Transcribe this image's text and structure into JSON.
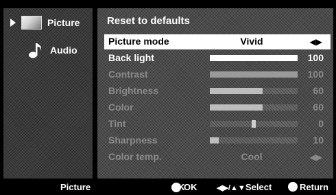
{
  "sidebar": {
    "items": [
      {
        "label": "Picture",
        "icon": "picture-icon",
        "selected": true
      },
      {
        "label": "Audio",
        "icon": "music-note-icon",
        "selected": false
      }
    ]
  },
  "main": {
    "title": "Reset to defaults",
    "picture_mode": {
      "label": "Picture mode",
      "value": "Vivid"
    },
    "settings": [
      {
        "label": "Back light",
        "value": "100",
        "level": 100,
        "enabled": true
      },
      {
        "label": "Contrast",
        "value": "100",
        "level": 100,
        "enabled": false
      },
      {
        "label": "Brightness",
        "value": "60",
        "level": 60,
        "enabled": false
      },
      {
        "label": "Color",
        "value": "60",
        "level": 60,
        "enabled": false
      },
      {
        "label": "Tint",
        "value": "0",
        "level": 0,
        "enabled": false
      },
      {
        "label": "Sharpness",
        "value": "10",
        "level": 10,
        "enabled": false
      }
    ],
    "color_temp": {
      "label": "Color temp.",
      "value": "Cool"
    }
  },
  "footer": {
    "section": "Picture",
    "ok_icon_text": "OK",
    "ok_label": "OK",
    "select_label": "Select",
    "return_label": "Return"
  }
}
